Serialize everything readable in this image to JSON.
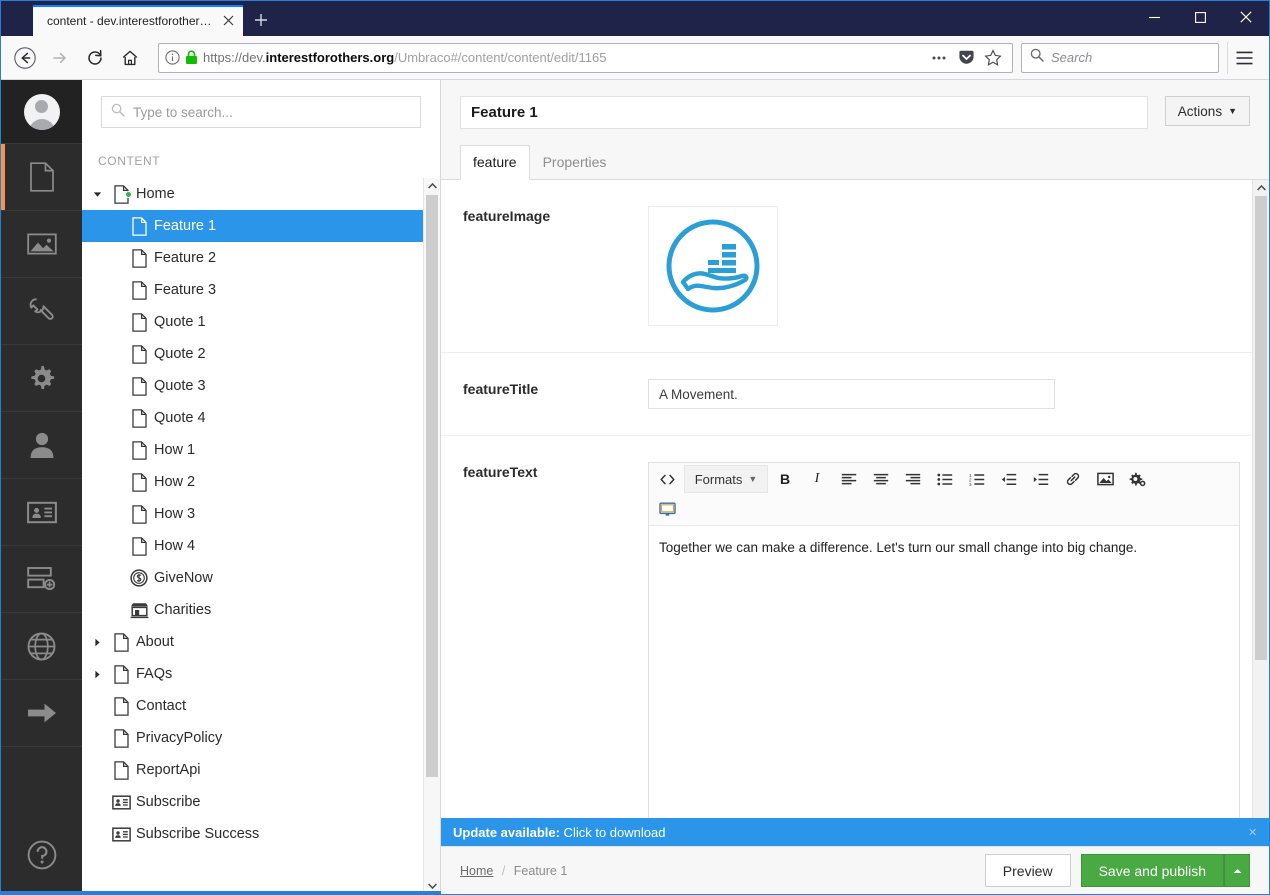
{
  "browser": {
    "tab": {
      "title": "content - dev.interestforothers.org",
      "close_icon": "close-icon"
    },
    "newtab_label": "+",
    "window_controls": {
      "minimize": "minimize-icon",
      "maximize": "maximize-icon",
      "close": "close-icon"
    },
    "nav": {
      "back_icon": "back-arrow-icon",
      "forward_icon": "forward-arrow-icon",
      "reload_icon": "reload-icon",
      "home_icon": "home-icon"
    },
    "url": {
      "info_icon": "page-info-icon",
      "lock_icon": "lock-icon",
      "scheme": "https://dev.",
      "host_bold": "interestforothers.org",
      "path": "/Umbraco#/content/content/edit/1165",
      "full": "https://dev.interestforothers.org/Umbraco#/content/content/edit/1165",
      "ellipsis_icon": "page-actions-icon",
      "pocket_icon": "pocket-icon",
      "bookmark_icon": "star-icon"
    },
    "search": {
      "placeholder": "Search",
      "icon": "search-icon"
    },
    "menu_icon": "hamburger-menu-icon"
  },
  "rail": {
    "avatar": "user-avatar",
    "items": [
      {
        "name": "content",
        "icon": "document-icon",
        "active": true
      },
      {
        "name": "media",
        "icon": "image-icon",
        "active": false
      },
      {
        "name": "settings",
        "icon": "wrench-icon",
        "active": false
      },
      {
        "name": "developer",
        "icon": "gear-icon",
        "active": false
      },
      {
        "name": "users",
        "icon": "user-icon",
        "active": false
      },
      {
        "name": "members",
        "icon": "id-card-icon",
        "active": false
      },
      {
        "name": "forms",
        "icon": "forms-icon",
        "active": false
      },
      {
        "name": "translation",
        "icon": "globe-icon",
        "active": false
      },
      {
        "name": "redirects",
        "icon": "arrow-right-icon",
        "active": false
      }
    ],
    "help_icon": "help-circle-icon",
    "active_accent": "#f09553"
  },
  "tree": {
    "search_placeholder": "Type to search...",
    "search_icon": "search-icon",
    "section_header": "CONTENT",
    "nodes": [
      {
        "label": "Home",
        "icon": "document-icon",
        "depth": 0,
        "arrow": "down",
        "selected": false,
        "published_dot": true
      },
      {
        "label": "Feature 1",
        "icon": "document-icon",
        "depth": 1,
        "arrow": "none",
        "selected": true
      },
      {
        "label": "Feature 2",
        "icon": "document-icon",
        "depth": 1,
        "arrow": "none",
        "selected": false
      },
      {
        "label": "Feature 3",
        "icon": "document-icon",
        "depth": 1,
        "arrow": "none",
        "selected": false
      },
      {
        "label": "Quote 1",
        "icon": "document-icon",
        "depth": 1,
        "arrow": "none",
        "selected": false
      },
      {
        "label": "Quote 2",
        "icon": "document-icon",
        "depth": 1,
        "arrow": "none",
        "selected": false
      },
      {
        "label": "Quote 3",
        "icon": "document-icon",
        "depth": 1,
        "arrow": "none",
        "selected": false
      },
      {
        "label": "Quote 4",
        "icon": "document-icon",
        "depth": 1,
        "arrow": "none",
        "selected": false
      },
      {
        "label": "How 1",
        "icon": "document-icon",
        "depth": 1,
        "arrow": "none",
        "selected": false
      },
      {
        "label": "How 2",
        "icon": "document-icon",
        "depth": 1,
        "arrow": "none",
        "selected": false
      },
      {
        "label": "How 3",
        "icon": "document-icon",
        "depth": 1,
        "arrow": "none",
        "selected": false
      },
      {
        "label": "How 4",
        "icon": "document-icon",
        "depth": 1,
        "arrow": "none",
        "selected": false
      },
      {
        "label": "GiveNow",
        "icon": "coin-dollar-icon",
        "depth": 1,
        "arrow": "none",
        "selected": false
      },
      {
        "label": "Charities",
        "icon": "store-icon",
        "depth": 1,
        "arrow": "none",
        "selected": false
      },
      {
        "label": "About",
        "icon": "document-icon",
        "depth": 0,
        "arrow": "right",
        "selected": false
      },
      {
        "label": "FAQs",
        "icon": "document-icon",
        "depth": 0,
        "arrow": "right",
        "selected": false
      },
      {
        "label": "Contact",
        "icon": "document-icon",
        "depth": 0,
        "arrow": "none",
        "selected": false
      },
      {
        "label": "PrivacyPolicy",
        "icon": "document-icon",
        "depth": 0,
        "arrow": "none",
        "selected": false
      },
      {
        "label": "ReportApi",
        "icon": "document-icon",
        "depth": 0,
        "arrow": "none",
        "selected": false
      },
      {
        "label": "Subscribe",
        "icon": "id-card-icon",
        "depth": 0,
        "arrow": "none",
        "selected": false
      },
      {
        "label": "Subscribe Success",
        "icon": "id-card-icon",
        "depth": 0,
        "arrow": "none",
        "selected": false
      }
    ],
    "selected_color": "#2b95e9"
  },
  "editor": {
    "name_value": "Feature 1",
    "actions_label": "Actions",
    "actions_caret": "caret-down-icon",
    "tabs": [
      {
        "label": "feature",
        "active": true
      },
      {
        "label": "Properties",
        "active": false
      }
    ],
    "properties": [
      {
        "label": "featureImage",
        "type": "image",
        "image_alt": "hand-holding-coins-icon"
      },
      {
        "label": "featureTitle",
        "type": "text",
        "value": "A Movement."
      },
      {
        "label": "featureText",
        "type": "richtext",
        "value": "Together we can make a difference. Let's turn our small change into big change."
      }
    ],
    "rte_toolbar_row1": [
      {
        "name": "source-code-button",
        "label": "<>",
        "kind": "glyph"
      },
      {
        "name": "formats-dropdown",
        "label": "Formats",
        "kind": "dropdown"
      },
      {
        "name": "bold-button",
        "label": "B",
        "kind": "bold"
      },
      {
        "name": "italic-button",
        "label": "I",
        "kind": "italic"
      },
      {
        "name": "align-left-button",
        "label": "",
        "kind": "align-left"
      },
      {
        "name": "align-center-button",
        "label": "",
        "kind": "align-center"
      },
      {
        "name": "align-right-button",
        "label": "",
        "kind": "align-right"
      },
      {
        "name": "bullet-list-button",
        "label": "",
        "kind": "ul"
      },
      {
        "name": "numbered-list-button",
        "label": "",
        "kind": "ol"
      },
      {
        "name": "outdent-button",
        "label": "",
        "kind": "outdent"
      },
      {
        "name": "indent-button",
        "label": "",
        "kind": "indent"
      },
      {
        "name": "link-button",
        "label": "",
        "kind": "link"
      },
      {
        "name": "insert-image-button",
        "label": "",
        "kind": "image"
      },
      {
        "name": "macro-button",
        "label": "",
        "kind": "macro"
      }
    ],
    "rte_toolbar_row2": [
      {
        "name": "embed-button",
        "label": "",
        "kind": "embed"
      }
    ]
  },
  "notification": {
    "title": "Update available:",
    "action": " Click to download",
    "close_icon": "close-icon",
    "color": "#2b95e9"
  },
  "footer": {
    "breadcrumb_root": "Home",
    "breadcrumb_sep": "/",
    "breadcrumb_current": "Feature 1",
    "preview_label": "Preview",
    "publish_label": "Save and publish",
    "publish_caret": "caret-up-icon",
    "publish_color": "#49a942"
  }
}
